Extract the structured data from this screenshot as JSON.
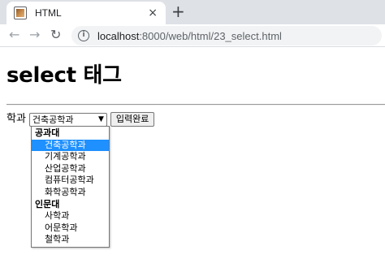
{
  "browser": {
    "tab_title": "HTML",
    "tab_close": "×",
    "new_tab": "+",
    "back": "←",
    "forward": "→",
    "reload": "↻",
    "info": "i",
    "url_host": "localhost",
    "url_path": ":8000/web/html/23_select.html"
  },
  "page": {
    "heading": "select 태그",
    "field_label": "학과",
    "select_value": "건축공학과",
    "select_arrow": "▼",
    "submit_label": "입력완료",
    "dropdown": {
      "groups": [
        {
          "label": "공과대",
          "options": [
            "건축공학과",
            "기계공학과",
            "산업공학과",
            "컴퓨터공학과",
            "화학공학과"
          ]
        },
        {
          "label": "인문대",
          "options": [
            "사학과",
            "어문학과",
            "철학과"
          ]
        }
      ],
      "selected": "건축공학과"
    }
  },
  "colors": {
    "highlight": "#1e90ff",
    "tabstrip": "#dee1e6",
    "omnibox": "#f1f3f4"
  }
}
